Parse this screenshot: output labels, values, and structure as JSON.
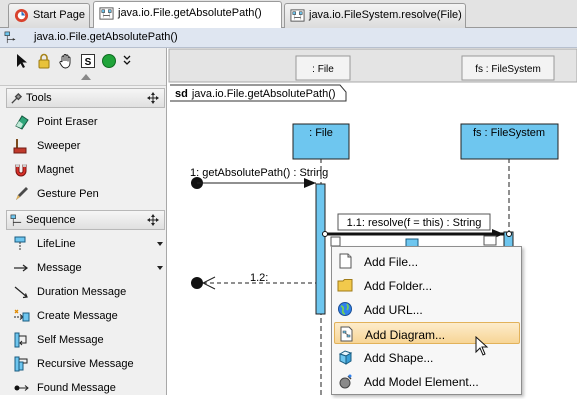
{
  "tabs": [
    {
      "label": "Start Page",
      "icon": "start-page-icon"
    },
    {
      "label": "java.io.File.getAbsolutePath()",
      "icon": "sequence-diagram-icon"
    },
    {
      "label": "java.io.FileSystem.resolve(File)",
      "icon": "sequence-diagram-icon"
    }
  ],
  "title": "java.io.File.getAbsolutePath()",
  "palette": {
    "tools_section": "Tools",
    "tools": [
      "Point Eraser",
      "Sweeper",
      "Magnet",
      "Gesture Pen"
    ],
    "sequence_section": "Sequence",
    "sequence_items": [
      "LifeLine",
      "Message",
      "Duration Message",
      "Create Message",
      "Self Message",
      "Recursive Message",
      "Found Message"
    ]
  },
  "diagram": {
    "header_file": ": File",
    "header_fs": "fs : FileSystem",
    "frame_label": "sd java.io.File.getAbsolutePath()",
    "frame_keyword": "sd",
    "frame_name": "java.io.File.getAbsolutePath()",
    "lifeline_file": ": File",
    "lifeline_fs": "fs : FileSystem",
    "message1": "1: getAbsolutePath() : String",
    "message11": "1.1: resolve(f = this) : String",
    "message12": "1.2:"
  },
  "context_menu": {
    "items": [
      "Add File...",
      "Add Folder...",
      "Add URL...",
      "Add Diagram...",
      "Add Shape...",
      "Add Model Element..."
    ],
    "highlighted": "Add Diagram..."
  },
  "colors": {
    "lifeline_fill": "#6ec6ef",
    "menu_highlight": "#f7d596",
    "title_bar": "#dfe6f1"
  }
}
